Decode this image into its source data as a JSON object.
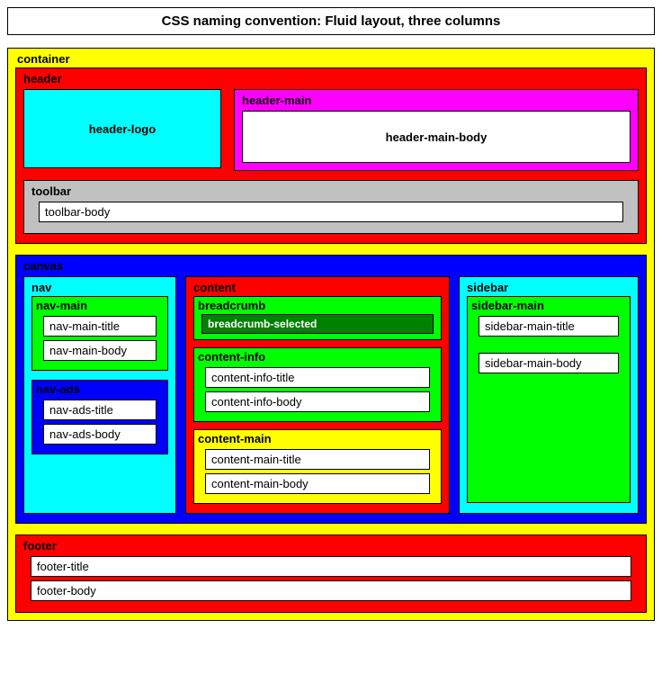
{
  "title": "CSS naming convention: Fluid layout, three columns",
  "container": {
    "label": "container"
  },
  "header": {
    "label": "header",
    "logo": "header-logo",
    "main": {
      "label": "header-main",
      "body": "header-main-body"
    },
    "toolbar": {
      "label": "toolbar",
      "body": "toolbar-body"
    }
  },
  "canvas": {
    "label": "canvas",
    "nav": {
      "label": "nav",
      "main": {
        "label": "nav-main",
        "title": "nav-main-title",
        "body": "nav-main-body"
      },
      "ads": {
        "label": "nav-ads",
        "title": "nav-ads-title",
        "body": "nav-ads-body"
      }
    },
    "content": {
      "label": "content",
      "breadcrumb": {
        "label": "breadcrumb",
        "selected": "breadcrumb-selected"
      },
      "info": {
        "label": "content-info",
        "title": "content-info-title",
        "body": "content-info-body"
      },
      "main": {
        "label": "content-main",
        "title": "content-main-title",
        "body": "content-main-body"
      }
    },
    "sidebar": {
      "label": "sidebar",
      "main": {
        "label": "sidebar-main",
        "title": "sidebar-main-title",
        "body": "sidebar-main-body"
      }
    }
  },
  "footer": {
    "label": "footer",
    "title": "footer-title",
    "body": "footer-body"
  }
}
